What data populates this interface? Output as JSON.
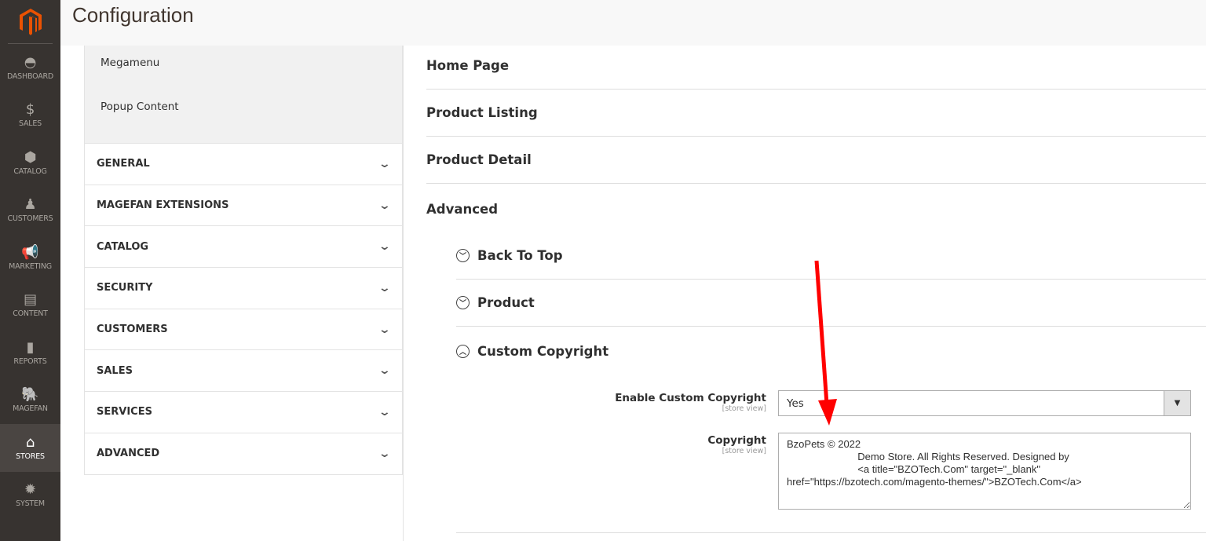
{
  "nav": [
    {
      "label": "DASHBOARD",
      "icon": "gauge-icon"
    },
    {
      "label": "SALES",
      "icon": "dollar-icon"
    },
    {
      "label": "CATALOG",
      "icon": "box-icon"
    },
    {
      "label": "CUSTOMERS",
      "icon": "person-icon"
    },
    {
      "label": "MARKETING",
      "icon": "megaphone-icon"
    },
    {
      "label": "CONTENT",
      "icon": "layout-icon"
    },
    {
      "label": "REPORTS",
      "icon": "bar-chart-icon"
    },
    {
      "label": "MAGEFAN",
      "icon": "elephant-icon"
    },
    {
      "label": "STORES",
      "icon": "store-icon",
      "active": true
    },
    {
      "label": "SYSTEM",
      "icon": "gear-icon"
    }
  ],
  "page_title": "Configuration",
  "left": {
    "subitems": [
      "Megamenu",
      "Popup Content"
    ],
    "groups": [
      "GENERAL",
      "MAGEFAN EXTENSIONS",
      "CATALOG",
      "SECURITY",
      "CUSTOMERS",
      "SALES",
      "SERVICES",
      "ADVANCED"
    ]
  },
  "sections": [
    "Home Page",
    "Product Listing",
    "Product Detail",
    "Advanced"
  ],
  "subsections": [
    "Back To Top",
    "Product",
    "Custom Copyright"
  ],
  "fields": {
    "enable_label": "Enable Custom Copyright",
    "scope": "[store view]",
    "enable_value": "Yes",
    "copyright_label": "Copyright",
    "copyright_value": "BzoPets © 2022\n                         Demo Store. All Rights Reserved. Designed by\n                         <a title=\"BZOTech.Com\" target=\"_blank\"\nhref=\"https://bzotech.com/magento-themes/\">BZOTech.Com</a>"
  },
  "colors": {
    "accent": "#eb5202",
    "annotation_arrow": "#ff0000"
  }
}
